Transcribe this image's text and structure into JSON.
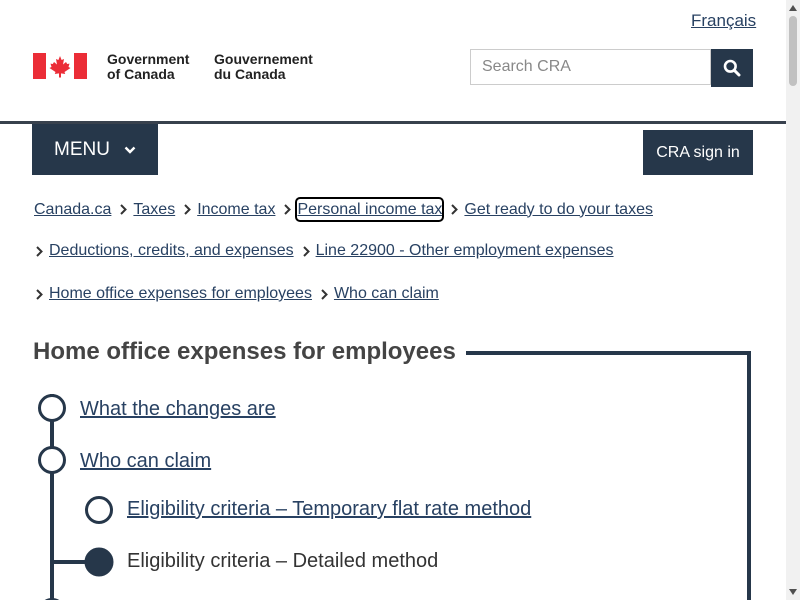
{
  "header": {
    "language_link": "Français",
    "gov_en_line1": "Government",
    "gov_en_line2": "of Canada",
    "gov_fr_line1": "Gouvernement",
    "gov_fr_line2": "du Canada",
    "search_placeholder": "Search CRA",
    "search_icon": "search-icon",
    "menu_label": "MENU",
    "signin_label": "CRA sign in",
    "brand_color": "#26374a",
    "flag_color": "#eb2d37"
  },
  "breadcrumbs": [
    "Canada.ca",
    "Taxes",
    "Income tax",
    "Personal income tax",
    "Get ready to do your taxes",
    "Deductions, credits, and expenses",
    "Line 22900 - Other employment expenses",
    "Home office expenses for employees",
    "Who can claim"
  ],
  "main": {
    "title": "Home office expenses for employees",
    "steps": [
      {
        "label": "What the changes are",
        "state": "link"
      },
      {
        "label": "Who can claim",
        "state": "link"
      },
      {
        "label": "Eligibility criteria – Temporary flat rate method",
        "state": "link"
      },
      {
        "label": "Eligibility criteria – Detailed method",
        "state": "current"
      }
    ]
  }
}
